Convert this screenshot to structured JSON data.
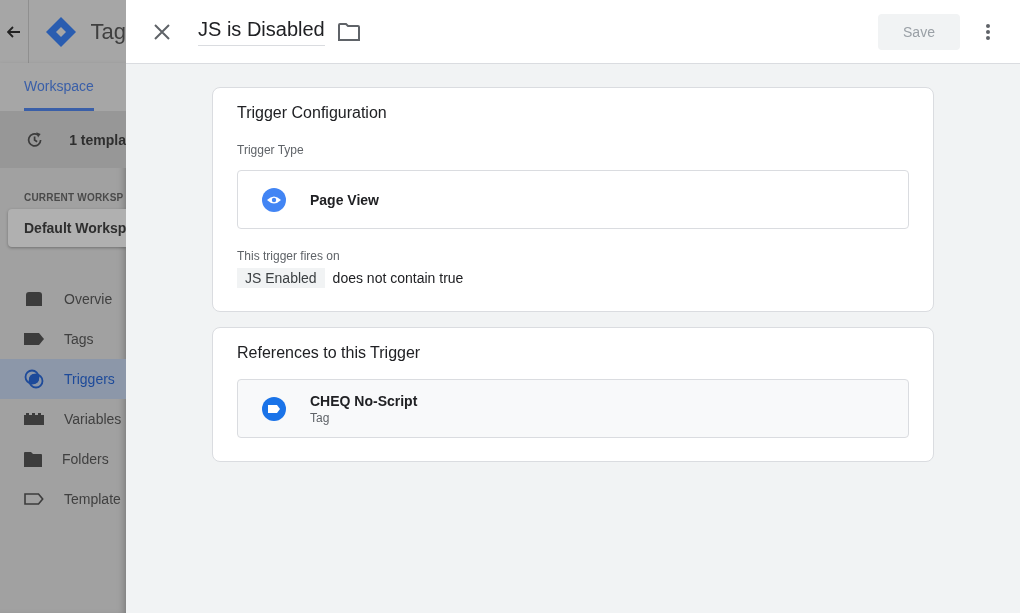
{
  "background_app": {
    "title": "Tag",
    "tabs": [
      {
        "label": "Workspace",
        "selected": true
      }
    ],
    "notice": "1 templa",
    "workspace_heading": "CURRENT WORKSP",
    "workspace_name": "Default Worksp",
    "nav": [
      {
        "label": "Overvie",
        "kind": "overview",
        "selected": false
      },
      {
        "label": "Tags",
        "kind": "tags",
        "selected": false
      },
      {
        "label": "Triggers",
        "kind": "triggers",
        "selected": true
      },
      {
        "label": "Variables",
        "kind": "variables",
        "selected": false
      },
      {
        "label": "Folders",
        "kind": "folders",
        "selected": false
      },
      {
        "label": "Template",
        "kind": "templates",
        "selected": false
      }
    ]
  },
  "drawer": {
    "title": "JS is Disabled",
    "save_button": {
      "label": "Save",
      "disabled": true
    },
    "trigger_configuration": {
      "title": "Trigger Configuration",
      "type_label": "Trigger Type",
      "trigger_type": "Page View",
      "fires_label": "This trigger fires on",
      "condition": {
        "variable": "JS Enabled",
        "operator": "does not contain true"
      }
    },
    "references": {
      "title": "References to this Trigger",
      "items": [
        {
          "name": "CHEQ No-Script",
          "type": "Tag"
        }
      ]
    }
  }
}
